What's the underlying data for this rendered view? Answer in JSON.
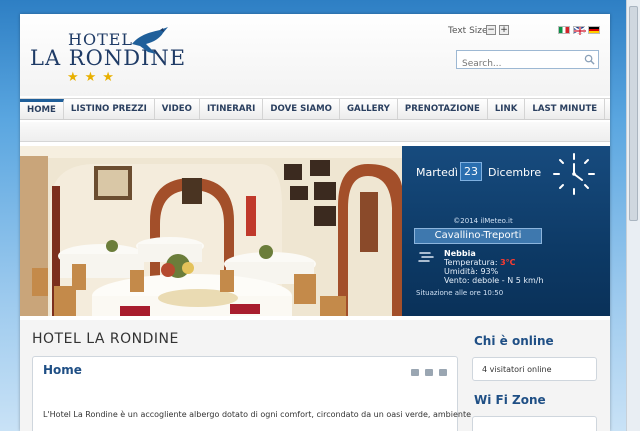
{
  "header": {
    "logo_hotel": "HOTEL",
    "logo_name": "LA RONDINE",
    "logo_stars": "★★★",
    "text_size_label": "Text Size",
    "text_size_minus": "−",
    "text_size_plus": "+",
    "search_placeholder": "Search...",
    "flags": [
      "italian-flag-icon",
      "uk-flag-icon",
      "german-flag-icon"
    ]
  },
  "nav": {
    "items": [
      "HOME",
      "LISTINO PREZZI",
      "VIDEO",
      "ITINERARI",
      "DOVE SIAMO",
      "GALLERY",
      "PRENOTAZIONE",
      "LINK",
      "LAST MINUTE"
    ],
    "active_index": 0
  },
  "weather": {
    "day": "Martedì",
    "date": "23",
    "month": "Dicembre",
    "credit": "©2014 ilMeteo.it",
    "city": "Cavallino-Treporti",
    "condition": "Nebbia",
    "temperature_label": "Temperatura:",
    "temperature_value": "3°C",
    "humidity": "Umidità: 93%",
    "wind": "Vento: debole - N 5 km/h",
    "situation": "Situazione alle ore 10:50"
  },
  "main": {
    "page_title": "HOTEL LA RONDINE",
    "article_title": "Home",
    "article_text": "L'Hotel La Rondine è un accogliente albergo dotato di ogni comfort, circondato da un oasi verde, ambiente"
  },
  "sidebar": {
    "online_title": "Chi è online",
    "online_text": "4 visitatori online",
    "wifi_title": "Wi Fi Zone"
  },
  "colors": {
    "brand_navy": "#1f3b66",
    "accent_blue": "#1f4f85",
    "weather_bg": "#0d3a66",
    "temperature_red": "#ff3b2f"
  }
}
